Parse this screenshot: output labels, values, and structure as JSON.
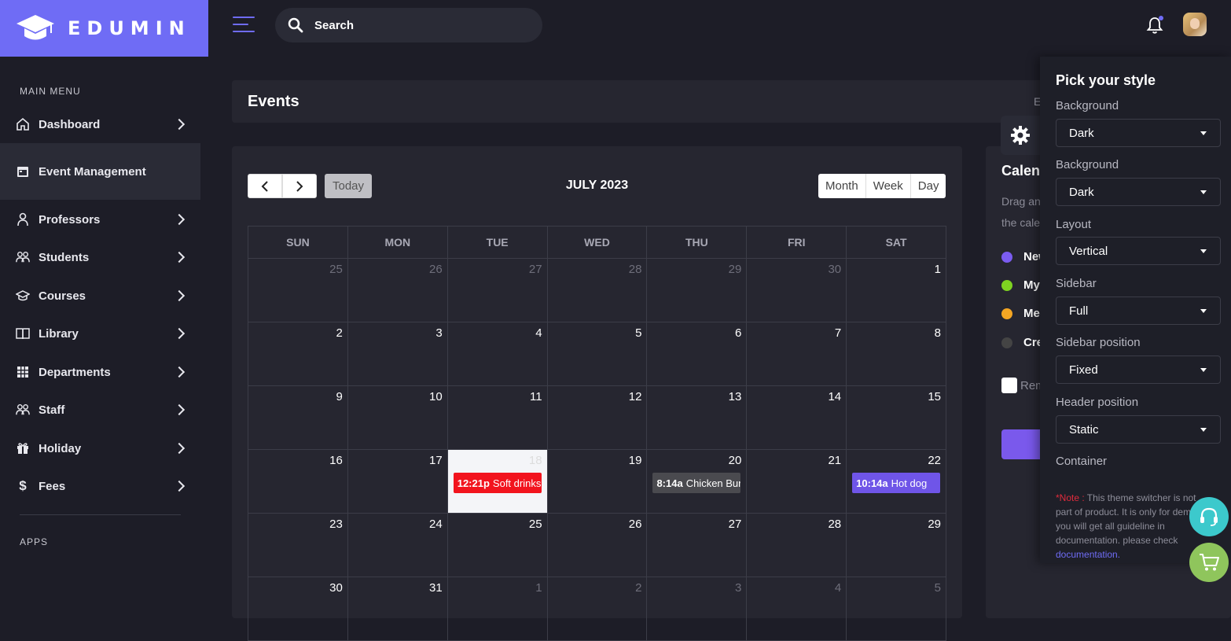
{
  "brand": {
    "name": "EDUMIN"
  },
  "search": {
    "placeholder": "Search"
  },
  "sidebar": {
    "main_menu_title": "MAIN MENU",
    "apps_title": "APPS",
    "items": [
      {
        "label": "Dashboard",
        "icon": "home-icon"
      },
      {
        "label": "Event Management",
        "icon": "calendar-icon",
        "active": true
      },
      {
        "label": "Professors",
        "icon": "user-icon"
      },
      {
        "label": "Students",
        "icon": "users-icon"
      },
      {
        "label": "Courses",
        "icon": "graduation-cap-icon"
      },
      {
        "label": "Library",
        "icon": "book-icon"
      },
      {
        "label": "Departments",
        "icon": "grid-icon"
      },
      {
        "label": "Staff",
        "icon": "users-icon"
      },
      {
        "label": "Holiday",
        "icon": "gift-icon"
      },
      {
        "label": "Fees",
        "icon": "dollar-icon"
      }
    ]
  },
  "page": {
    "title": "Events",
    "breadcrumb_fragment": "E"
  },
  "calendar": {
    "title": "JULY 2023",
    "today_label": "Today",
    "views": [
      "Month",
      "Week",
      "Day"
    ],
    "weekdays": [
      "SUN",
      "MON",
      "TUE",
      "WED",
      "THU",
      "FRI",
      "SAT"
    ],
    "weeks": [
      [
        "25",
        "26",
        "27",
        "28",
        "29",
        "30",
        "1"
      ],
      [
        "2",
        "3",
        "4",
        "5",
        "6",
        "7",
        "8"
      ],
      [
        "9",
        "10",
        "11",
        "12",
        "13",
        "14",
        "15"
      ],
      [
        "16",
        "17",
        "18",
        "19",
        "20",
        "21",
        "22"
      ],
      [
        "23",
        "24",
        "25",
        "26",
        "27",
        "28",
        "29"
      ],
      [
        "30",
        "31",
        "1",
        "2",
        "3",
        "4",
        "5"
      ]
    ],
    "events": [
      {
        "time": "12:21p",
        "title": "Soft drinks",
        "color": "#f2141e"
      },
      {
        "time": "8:14a",
        "title": "Chicken Burger",
        "color": "#4a4a4f"
      },
      {
        "time": "10:14a",
        "title": "Hot dog",
        "color": "#6f55e8"
      }
    ]
  },
  "right_panel": {
    "title": "Calendar",
    "text_line1": "Drag and",
    "text_line2": "the calendar",
    "items": [
      {
        "label": "New",
        "color": "#7b5cf0"
      },
      {
        "label": "My",
        "color": "#7ed321"
      },
      {
        "label": "Meet",
        "color": "#f5a623"
      },
      {
        "label": "Create",
        "color": "#444444"
      }
    ],
    "checkbox_label": "Rem"
  },
  "style_panel": {
    "title": "Pick your style",
    "fields": [
      {
        "label": "Background",
        "value": "Dark"
      },
      {
        "label": "Background",
        "value": "Dark"
      },
      {
        "label": "Layout",
        "value": "Vertical"
      },
      {
        "label": "Sidebar",
        "value": "Full"
      },
      {
        "label": "Sidebar position",
        "value": "Fixed"
      },
      {
        "label": "Header position",
        "value": "Static"
      }
    ],
    "container_label": "Container",
    "note_prefix": "*Note :",
    "note_body": " This theme switcher is not part of product. It is only for demo. you will get all guideline in documentation. please check ",
    "note_link": "documentation."
  },
  "colors": {
    "accent": "#6f6cf5",
    "background": "#1d1d27",
    "card": "#262630"
  }
}
